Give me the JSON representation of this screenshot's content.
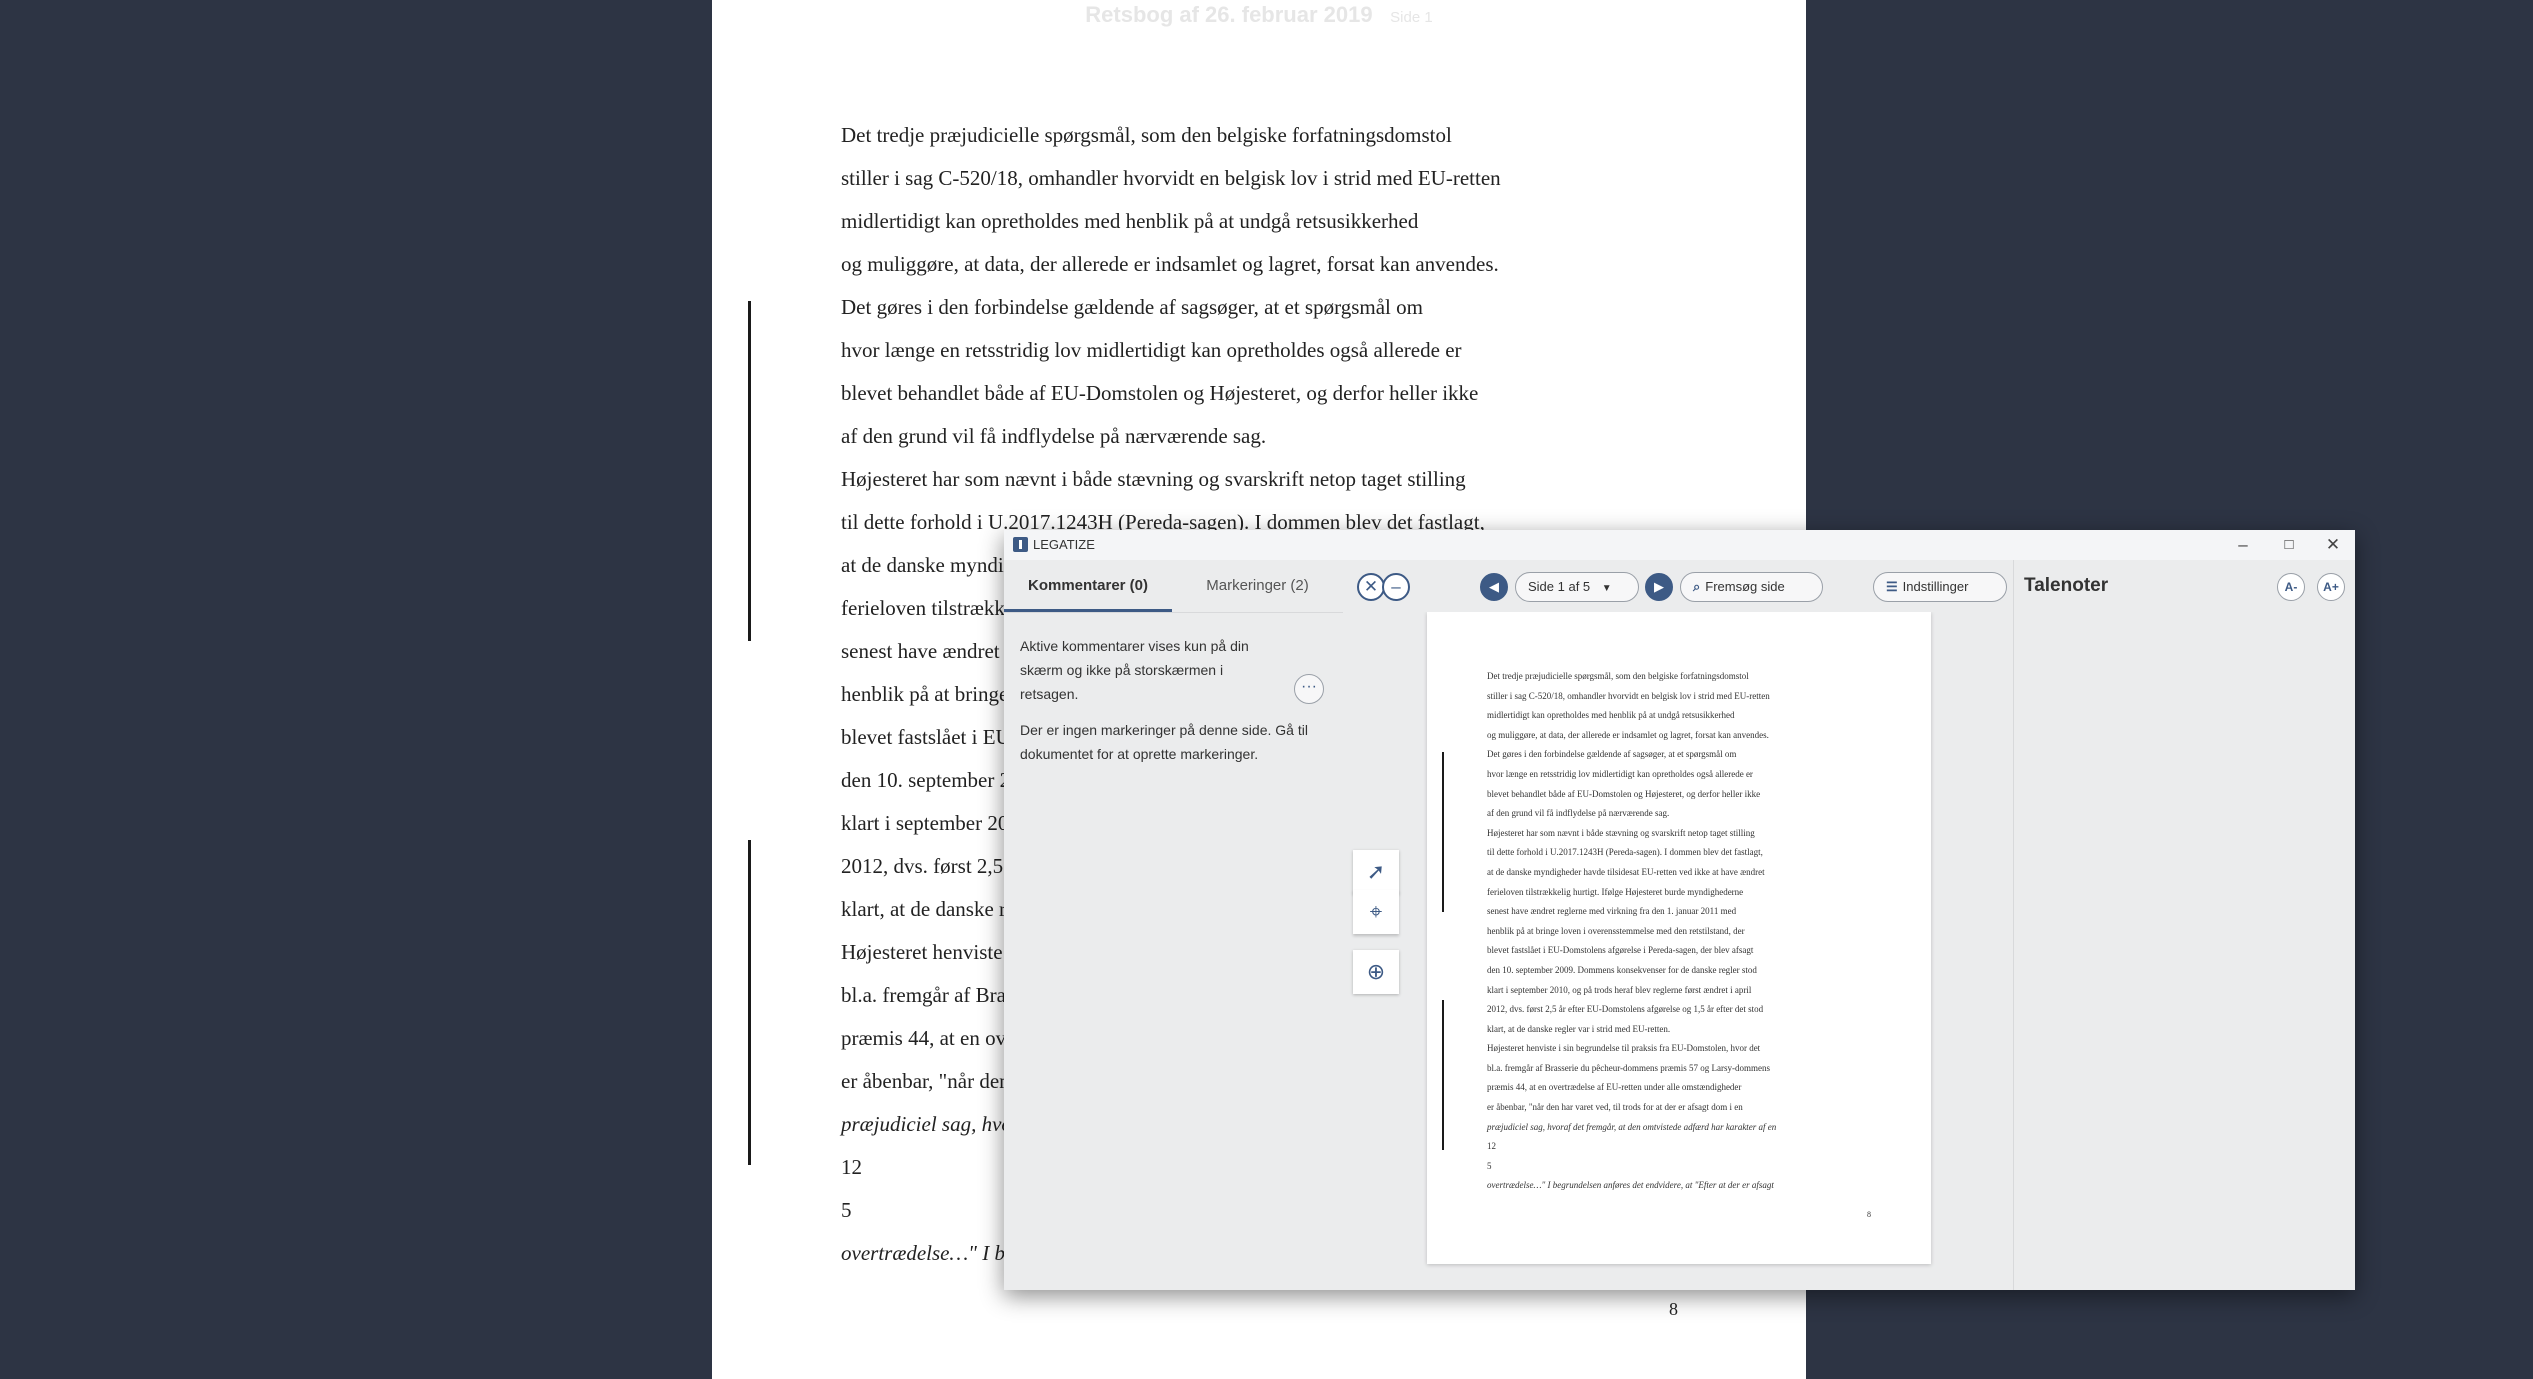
{
  "background_document": {
    "header_title": "Retsbog af 26. februar 2019",
    "header_page": "Side 1",
    "lines": [
      "Det tredje præjudicielle spørgsmål, som den belgiske forfatningsdomstol",
      "stiller i sag C-520/18, omhandler hvorvidt en belgisk lov i strid med EU-retten",
      "midlertidigt kan opretholdes med henblik på at undgå retsusikkerhed",
      "og muliggøre, at data, der allerede er indsamlet og lagret, forsat kan anvendes.",
      "Det gøres i den forbindelse gældende af sagsøger, at et spørgsmål om",
      "hvor længe en retsstridig lov midlertidigt kan opretholdes også allerede er",
      "blevet behandlet både af EU-Domstolen og Højesteret, og derfor heller ikke",
      "af den grund vil få indflydelse på nærværende sag.",
      "Højesteret har som nævnt i både stævning og svarskrift netop taget stilling",
      "til dette forhold i U.2017.1243H (Pereda-sagen). I dommen blev det fastlagt,",
      "at de danske myndigheder havde tilsidesat EU-retten ved ikke at have ændret",
      "ferieloven tilstrækkelig hurtigt. Ifølge Højesteret burde myndighederne",
      "senest have ændret reglerne med virkning fra den 1. januar 2011 med",
      "henblik på at bringe loven i overensstemmelse med den retstilstand, der",
      "blevet fastslået i EU-Domstolens afgørelse i Pereda-sagen, der blev afsagt",
      "den 10. september 2009. Dommens konsekvenser for de danske regler stod",
      "klart i september 2010, og på trods heraf blev reglerne først ændret i april",
      "2012, dvs. først 2,5 år efter EU-Domstolens afgørelse og 1,5 år efter det stod",
      "klart, at de danske regler var i strid med EU-retten.",
      "Højesteret henviste i sin begrundelse til praksis fra EU-Domstolen, hvor det",
      "bl.a. fremgår af Brasserie du pêcheur-dommens præmis 57 og Larsy-dommens",
      "præmis 44, at en overtrædelse af EU-retten under alle omstændigheder",
      "er åbenbar, \"når den har varet ved, til trods for at der er afsagt dom i en",
      "præjudiciel sag, hvoraf det fremgår, at den omtvistede adfærd har karakter af en",
      "12",
      "5",
      "overtrædelse…\" I begrundelsen anføres det endvidere, at \"Efter at der er afsagt"
    ],
    "page_number": "8"
  },
  "app": {
    "title": "LEGATIZE",
    "window_controls": {
      "minimize": "–",
      "maximize": "□",
      "close": "✕"
    },
    "tabs": {
      "comments": "Kommentarer (0)",
      "markings": "Markeringer (2)"
    },
    "comments_info": "Aktive kommentarer vises kun på din skærm og ikke på storskærmen i retsagen.",
    "no_markings": "Der er ingen markeringer på denne side. Gå til dokumentet for at oprette markeringer.",
    "more_label": "···",
    "toolbar": {
      "page_select": "Side 1 af 5",
      "search_page": "Fremsøg side",
      "settings": "Indstillinger"
    },
    "notes": {
      "title": "Talenoter",
      "font_smaller": "A-",
      "font_larger": "A+"
    },
    "icons": [
      "close-circle-icon",
      "minus-circle-icon",
      "previous-page-icon",
      "next-page-icon",
      "search-page-icon",
      "settings-sliders-icon",
      "pointer-icon",
      "crosshair-icon",
      "zoom-page-icon"
    ],
    "accent_color": "#3d5a85"
  }
}
